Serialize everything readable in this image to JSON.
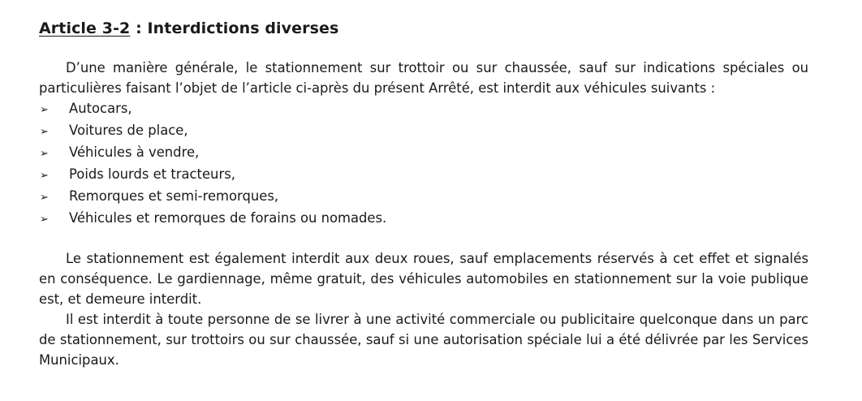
{
  "article": {
    "number": "Article 3-2",
    "separator": " : ",
    "title": "Interdictions diverses"
  },
  "paragraphs": {
    "intro": "D’une manière générale, le stationnement sur trottoir ou sur chaussée, sauf sur indications spéciales ou particulières faisant l’objet de l’article ci-après du présent Arrêté, est interdit aux véhicules suivants :",
    "second": "Le stationnement est également interdit aux deux roues, sauf emplacements réservés à cet effet et signalés en conséquence. Le gardiennage, même gratuit, des véhicules automobiles en stationnement sur la voie publique est, et demeure interdit.",
    "third": "Il est interdit à toute personne de se livrer à une activité commerciale ou publicitaire quelconque dans un parc de stationnement, sur trottoirs ou sur chaussée, sauf si une autorisation spéciale lui a été délivrée par les Services Municipaux."
  },
  "bullet_icon": "arrowhead-bullet-icon",
  "vehicles": [
    "Autocars,",
    "Voitures de place,",
    "Véhicules à vendre,",
    "Poids lourds et tracteurs,",
    "Remorques et semi-remorques,",
    "Véhicules et remorques de forains ou nomades."
  ]
}
